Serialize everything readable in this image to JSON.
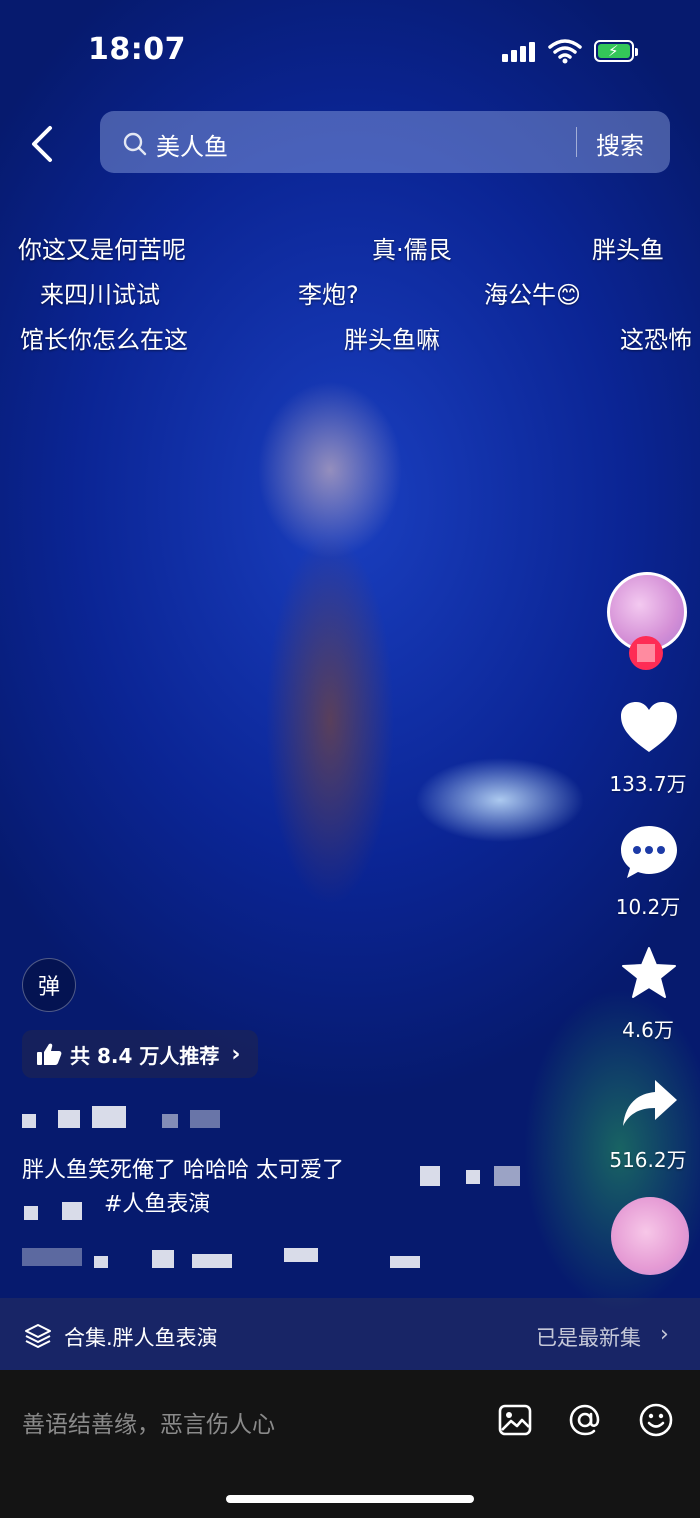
{
  "status_bar": {
    "time": "18:07"
  },
  "header": {
    "search_query": "美人鱼",
    "search_button": "搜索"
  },
  "danmaku": [
    "你这又是何苦呢",
    "真·儒艮",
    "胖头鱼",
    "来四川试试",
    "李炮?",
    "海公牛😊",
    "馆长你怎么在这",
    "胖头鱼嘛",
    "这恐怖"
  ],
  "actions": {
    "like_count": "133.7万",
    "comment_count": "10.2万",
    "favorite_count": "4.6万",
    "share_count": "516.2万"
  },
  "danmaku_toggle": "弹",
  "recommend": {
    "label": "共 8.4 万人推荐"
  },
  "post": {
    "caption": "胖人鱼笑死俺了 哈哈哈 太可爱了",
    "hashtag": "#人鱼表演"
  },
  "collection": {
    "title": "合集.胖人鱼表演",
    "status": "已是最新集"
  },
  "comment_bar": {
    "placeholder": "善语结善缘，恶言伤人心"
  },
  "colors": {
    "background": "#0b2595",
    "follow_badge": "#fe2c55",
    "comment_bar": "#141414"
  },
  "icons": [
    "back-icon",
    "search-icon",
    "heart-icon",
    "comment-icon",
    "star-icon",
    "share-icon",
    "thumbs-up-icon",
    "layers-icon",
    "image-icon",
    "at-icon",
    "emoji-icon"
  ]
}
